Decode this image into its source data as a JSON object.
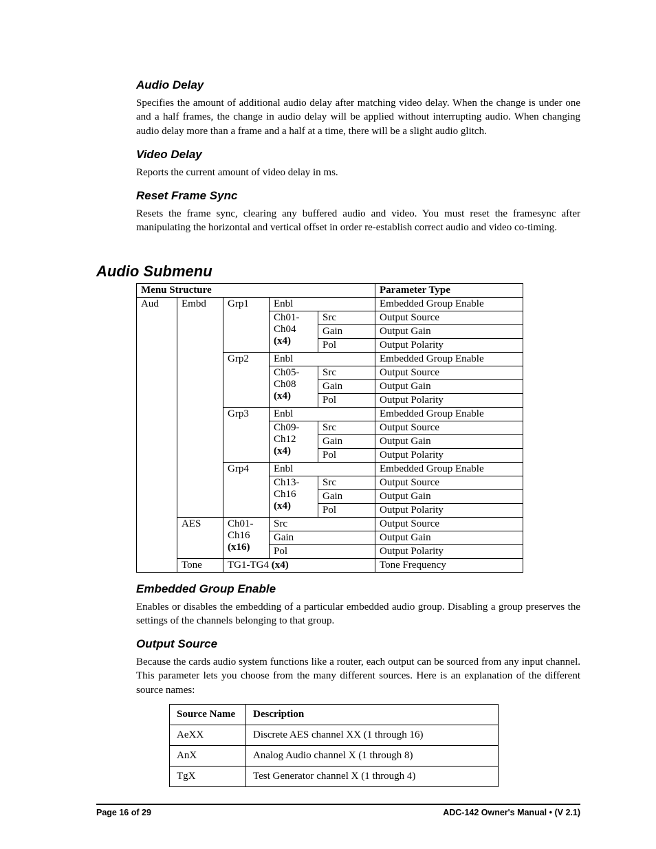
{
  "sections": {
    "audio_delay": {
      "heading": "Audio Delay",
      "body": " Specifies the amount of additional  audio delay after matching video delay.  When the change is under one and a half frames, the change in audio delay will be applied without interrupting audio.  When changing audio delay more than a frame and a half at a time, there will be a slight audio glitch."
    },
    "video_delay": {
      "heading": "Video Delay",
      "body": "Reports the current amount of video delay in ms."
    },
    "reset_frame_sync": {
      "heading": "Reset Frame Sync",
      "body": "Resets the frame sync, clearing any buffered audio and video. You must reset the framesync after manipulating the horizontal and vertical offset in order re-establish correct audio and video co-timing."
    },
    "audio_submenu": {
      "heading": "Audio Submenu"
    },
    "embedded_group_enable": {
      "heading": "Embedded Group Enable",
      "body": "Enables or disables the embedding of a particular embedded audio group. Disabling a group preserves the settings of the channels belonging to that group."
    },
    "output_source": {
      "heading": "Output Source",
      "body": "Because the cards audio system functions like a router, each output can be sourced from any input channel. This parameter lets you choose from the many different sources. Here is an explanation of the different source names:"
    }
  },
  "menu_table": {
    "header": {
      "structure": "Menu Structure",
      "param_type": "Parameter Type"
    },
    "col_aud": "Aud",
    "col_embd": "Embd",
    "groups": [
      {
        "grp": "Grp1",
        "ch_a": "Ch01-",
        "ch_b": "Ch04",
        "mult": "(x4)"
      },
      {
        "grp": "Grp2",
        "ch_a": "Ch05-",
        "ch_b": "Ch08",
        "mult": "(x4)"
      },
      {
        "grp": "Grp3",
        "ch_a": "Ch09-",
        "ch_b": "Ch12",
        "mult": "(x4)"
      },
      {
        "grp": "Grp4",
        "ch_a": "Ch13-",
        "ch_b": "Ch16",
        "mult": "(x4)"
      }
    ],
    "labels": {
      "enbl": "Enbl",
      "src": "Src",
      "gain": "Gain",
      "pol": "Pol",
      "ege": "Embedded Group Enable",
      "osrc": "Output Source",
      "ogain": "Output Gain",
      "opol": "Output Polarity"
    },
    "aes": {
      "label": "AES",
      "ch_a": "Ch01-",
      "ch_b": "Ch16",
      "mult": "(x16)",
      "rows": [
        {
          "p": "Src",
          "d": "Output Source"
        },
        {
          "p": "Gain",
          "d": "Output Gain"
        },
        {
          "p": "Pol",
          "d": "Output Polarity"
        }
      ]
    },
    "tone": {
      "label": "Tone",
      "range_a": "TG1-TG4 ",
      "range_b": "(x4)",
      "desc": "Tone Frequency"
    }
  },
  "source_table": {
    "header": {
      "name": "Source Name",
      "desc": "Description"
    },
    "rows": [
      {
        "name": "AeXX",
        "desc": "Discrete AES channel XX (1 through 16)"
      },
      {
        "name": "AnX",
        "desc": "Analog Audio channel X (1 through 8)"
      },
      {
        "name": "TgX",
        "desc": "Test Generator channel X (1 through 4)"
      }
    ]
  },
  "footer": {
    "left": "Page 16 of 29",
    "right_a": "ADC-142 Owner's Manual  ",
    "right_b": "  (V 2.1)"
  }
}
